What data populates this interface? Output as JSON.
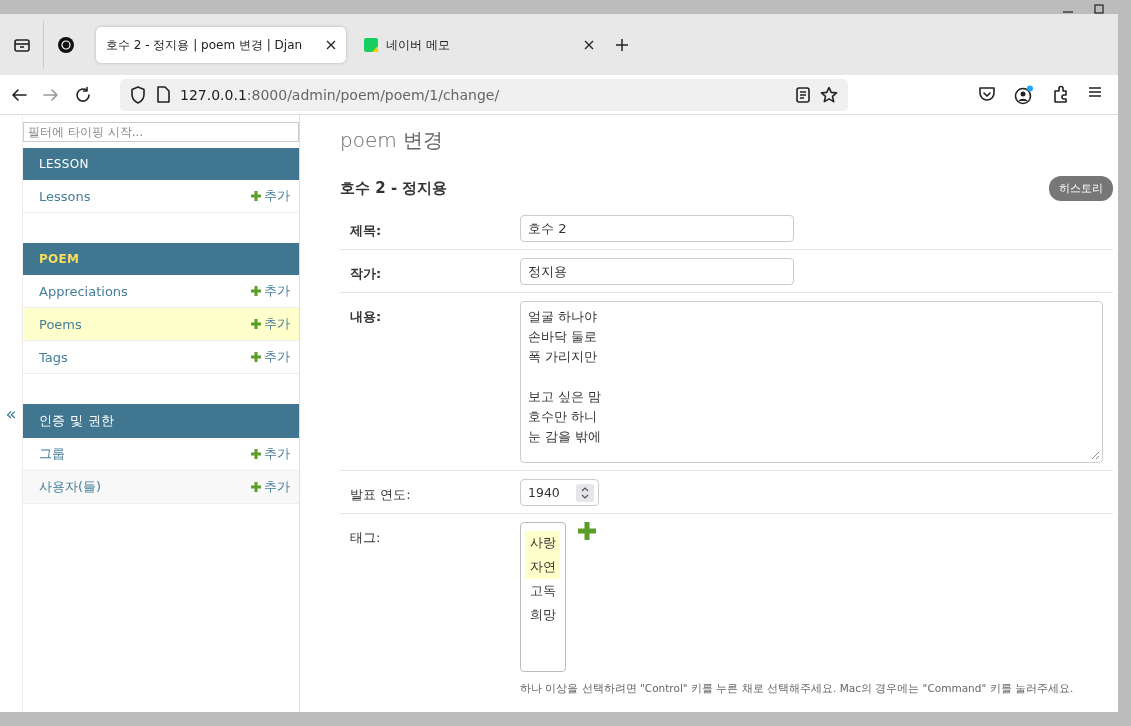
{
  "browser": {
    "tabs": [
      {
        "kind": "pinned"
      },
      {
        "kind": "pinned"
      },
      {
        "kind": "page",
        "title": "호수 2 - 정지용 | poem 변경 | Djan",
        "selected": true
      },
      {
        "kind": "page",
        "title": "네이버 메모",
        "selected": false
      }
    ],
    "url": {
      "host": "127.0.0.1",
      "rest": ":8000/admin/poem/poem/1/change/"
    }
  },
  "sidebar": {
    "filter_placeholder": "필터에 타이핑 시작...",
    "collapse_label": "«",
    "modules": [
      {
        "name": "LESSON",
        "current": false,
        "models": [
          {
            "name": "Lessons",
            "add": "추가",
            "selected": false
          }
        ]
      },
      {
        "name": "POEM",
        "current": true,
        "models": [
          {
            "name": "Appreciations",
            "add": "추가",
            "selected": false
          },
          {
            "name": "Poems",
            "add": "추가",
            "selected": true
          },
          {
            "name": "Tags",
            "add": "추가",
            "selected": false
          }
        ]
      },
      {
        "name": "인증 및 권한",
        "current": false,
        "models": [
          {
            "name": "그룹",
            "add": "추가",
            "selected": false
          },
          {
            "name": "사용자(들)",
            "add": "추가",
            "selected": false
          }
        ]
      }
    ]
  },
  "main": {
    "title": "poem 변경",
    "object_title": "호수 2 - 정지용",
    "history_button": "히스토리",
    "fields": [
      {
        "kind": "text",
        "label": "제목:",
        "required": true,
        "value": "호수 2"
      },
      {
        "kind": "text",
        "label": "작가:",
        "required": true,
        "value": "정지용"
      },
      {
        "kind": "textarea",
        "label": "내용:",
        "required": true,
        "value": "얼굴 하나야\n손바닥 둘로\n폭 가리지만\n\n보고 싶은 맘\n호수만 하니\n눈 감을 밖에"
      },
      {
        "kind": "number",
        "label": "발표 연도:",
        "required": false,
        "value": "1940"
      },
      {
        "kind": "multiselect",
        "label": "태그:",
        "required": false,
        "options": [
          {
            "label": "사랑",
            "selected": true
          },
          {
            "label": "자연",
            "selected": true
          },
          {
            "label": "고독",
            "selected": false
          },
          {
            "label": "희망",
            "selected": false
          }
        ],
        "help": "하나 이상을 선택하려면 \"Control\" 키를 누른 채로 선택해주세요. Mac의 경우에는 \"Command\" 키를 눌러주세요."
      }
    ]
  }
}
